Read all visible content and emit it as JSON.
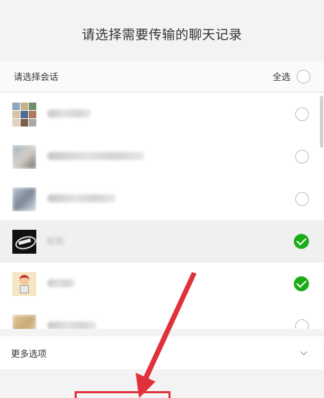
{
  "dialog": {
    "title": "请选择需要传输的聊天记录"
  },
  "selector": {
    "label": "请选择会话",
    "select_all_label": "全选",
    "select_all_checked": false
  },
  "conversations": [
    {
      "avatar": "group-grid-avatar",
      "selected": false
    },
    {
      "avatar": "blurred-avatar",
      "selected": false
    },
    {
      "avatar": "blurred-avatar",
      "selected": false
    },
    {
      "avatar": "dark-logo-avatar",
      "selected": true
    },
    {
      "avatar": "cartoon-avatar",
      "selected": true
    },
    {
      "avatar": "blurred-avatar",
      "selected": false
    }
  ],
  "more_options": {
    "label": "更多选项",
    "icon": "chevron-down-icon"
  },
  "colors": {
    "checked": "#1aad19",
    "annotation": "#e0313a",
    "background": "#f3f3f3"
  }
}
